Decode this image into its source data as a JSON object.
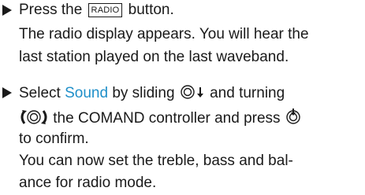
{
  "step1": {
    "text_before_key": "Press the",
    "key_label": "RADIO",
    "text_after_key": "button.",
    "result_line1": "The radio display appears. You will hear the",
    "result_line2": "last station played on the last waveband."
  },
  "step2": {
    "text_select": "Select",
    "highlight_word": "Sound",
    "text_by_sliding": "by sliding",
    "text_and_turning": "and turning",
    "text_controller": "the COMAND controller and press",
    "text_to_confirm": "to confirm.",
    "result_line1": "You can now set the treble, bass and bal-",
    "result_line2": "ance for radio mode."
  },
  "colors": {
    "text": "#1a1a1a",
    "highlight": "#1f8fc9"
  },
  "icons": [
    "step-arrow-icon",
    "controller-slide-down-icon",
    "controller-turn-icon",
    "controller-press-icon"
  ]
}
